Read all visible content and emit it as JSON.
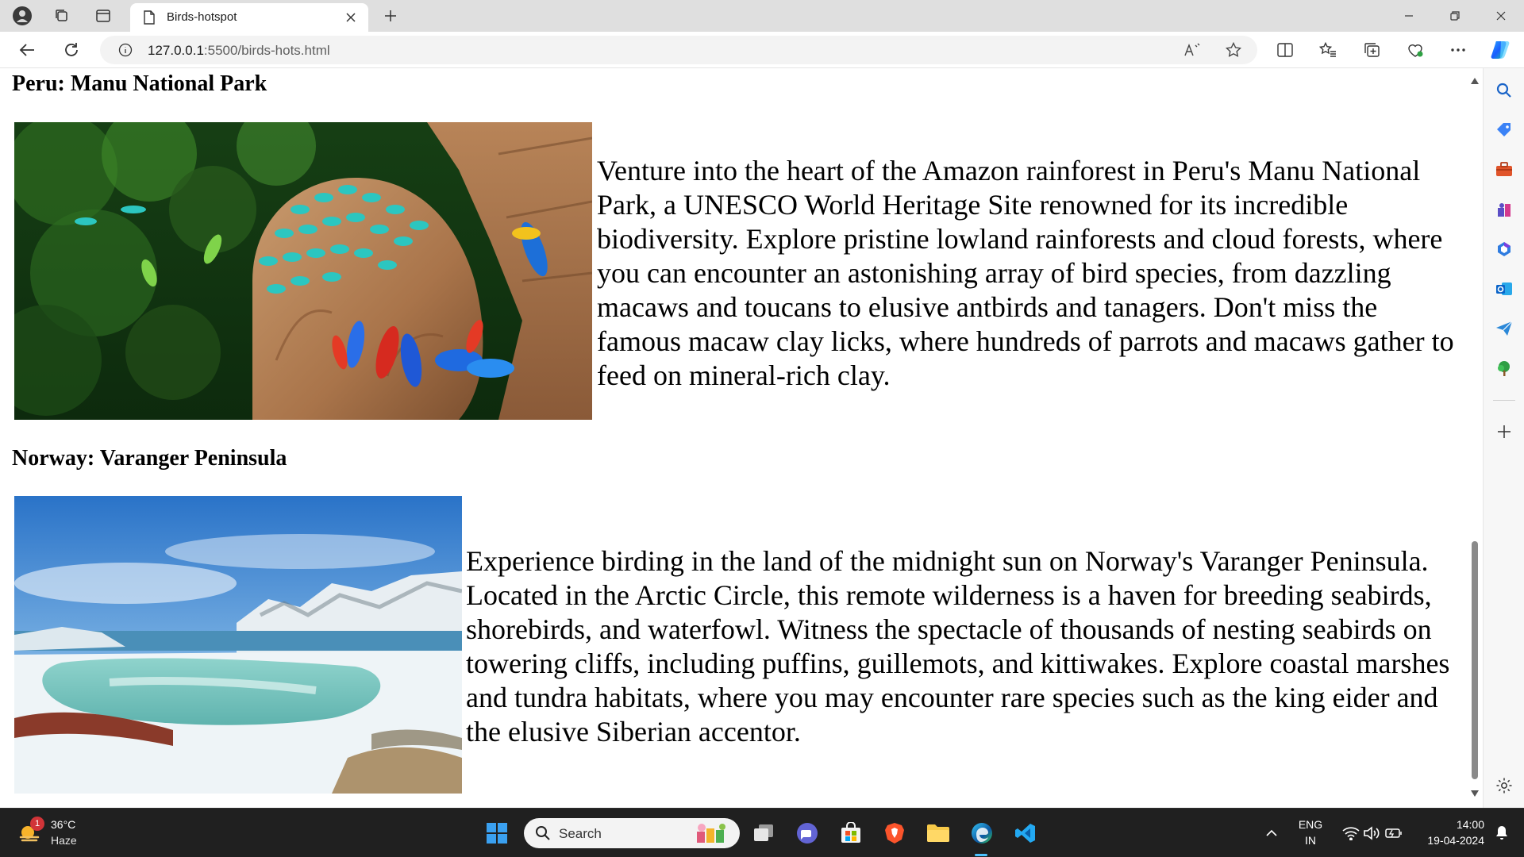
{
  "browser": {
    "tab_title": "Birds-hotspot",
    "url_host": "127.0.0.1",
    "url_path": ":5500/birds-hots.html"
  },
  "page": {
    "sections": [
      {
        "heading": "Peru: Manu National Park",
        "image": "macaws-clay-lick",
        "text": "Venture into the heart of the Amazon rainforest in Peru's Manu National Park, a UNESCO World Heritage Site renowned for its incredible biodiversity. Explore pristine lowland rainforests and cloud forests, where you can encounter an astonishing array of bird species, from dazzling macaws and toucans to elusive antbirds and tanagers. Don't miss the famous macaw clay licks, where hundreds of parrots and macaws gather to feed on mineral-rich clay."
      },
      {
        "heading": "Norway: Varanger Peninsula",
        "image": "arctic-snowy-coast",
        "text": "Experience birding in the land of the midnight sun on Norway's Varanger Peninsula. Located in the Arctic Circle, this remote wilderness is a haven for breeding seabirds, shorebirds, and waterfowl. Witness the spectacle of thousands of nesting seabirds on towering cliffs, including puffins, guillemots, and kittiwakes. Explore coastal marshes and tundra habitats, where you may encounter rare species such as the king eider and the elusive Siberian accentor."
      }
    ]
  },
  "taskbar": {
    "weather_temp": "36°C",
    "weather_desc": "Haze",
    "weather_badge": "1",
    "search_label": "Search",
    "lang_top": "ENG",
    "lang_bottom": "IN",
    "time": "14:00",
    "date": "19-04-2024"
  },
  "colors": {
    "edge_accent": "#0078d4",
    "taskbar_bg": "#202020",
    "titlebar_bg": "#dfdfdf"
  }
}
